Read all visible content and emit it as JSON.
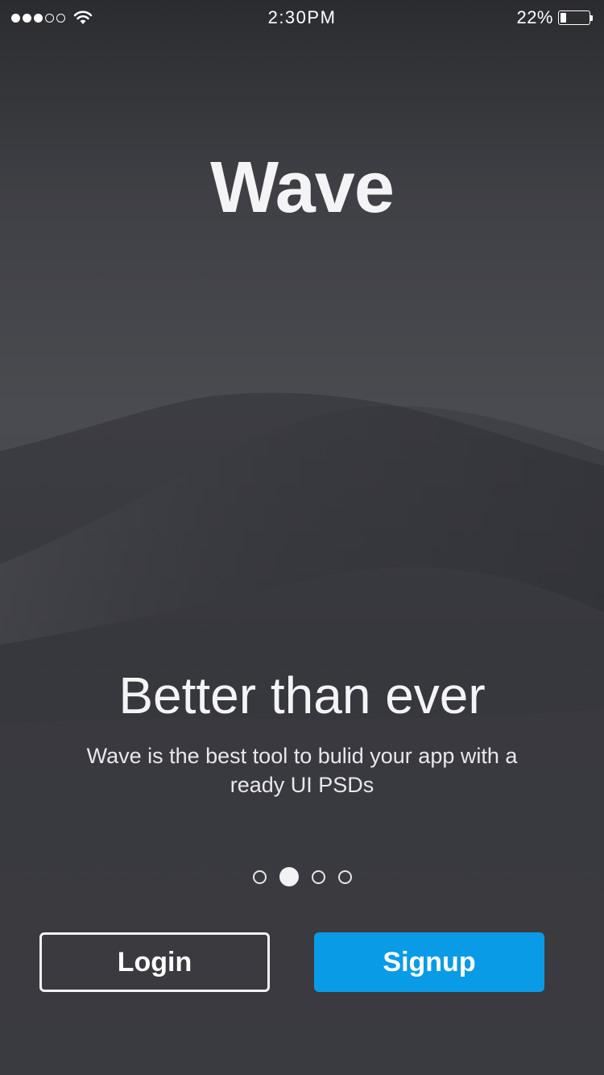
{
  "status_bar": {
    "time": "2:30PM",
    "battery_percent": "22%",
    "battery_level": 0.22,
    "signal_bars_filled": 3,
    "signal_bars_total": 5
  },
  "app": {
    "title": "Wave"
  },
  "onboarding": {
    "headline": "Better than ever",
    "subtitle": "Wave is the best tool to bulid your app with a ready UI PSDs",
    "page_count": 4,
    "active_page": 2
  },
  "actions": {
    "login_label": "Login",
    "signup_label": "Signup"
  },
  "colors": {
    "accent": "#0a9be6",
    "background": "#3f4045",
    "text": "#f4f4f6"
  },
  "icons": {
    "signal": "signal-dots-icon",
    "wifi": "wifi-icon",
    "battery": "battery-icon"
  }
}
